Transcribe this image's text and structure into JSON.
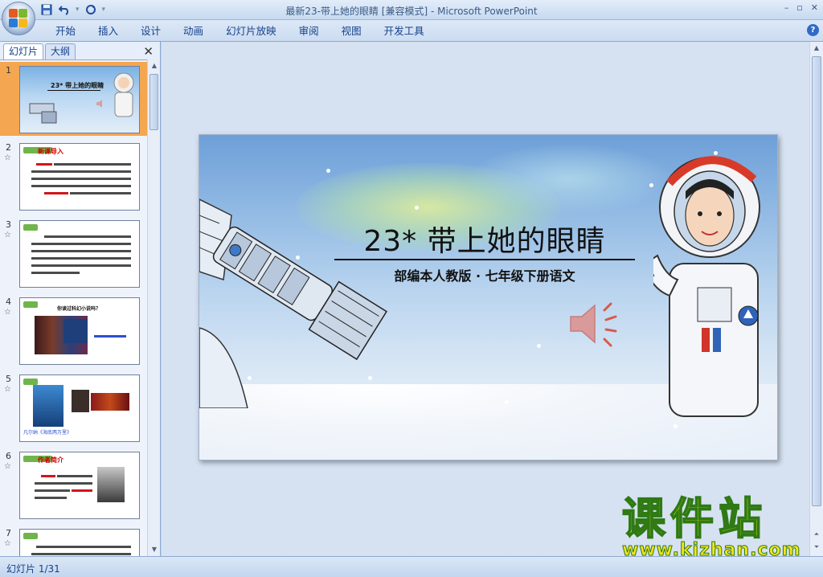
{
  "window": {
    "title": "最新23-带上她的眼睛 [兼容模式] - Microsoft PowerPoint",
    "controls": [
      "–",
      "▫",
      "✕"
    ]
  },
  "quick_access": {
    "icons": [
      "save-icon",
      "undo-icon",
      "redo-icon",
      "customize-icon"
    ]
  },
  "ribbon": {
    "tabs": [
      "开始",
      "插入",
      "设计",
      "动画",
      "幻灯片放映",
      "审阅",
      "视图",
      "开发工具"
    ],
    "help_label": "?"
  },
  "left_panel": {
    "tabs": [
      "幻灯片",
      "大纲"
    ],
    "active_tab": "幻灯片",
    "close_label": "✕",
    "thumbnails": [
      {
        "num": "1",
        "selected": true,
        "title": "23*  带上她的眼睛"
      },
      {
        "num": "2",
        "star": "☆",
        "tag": "新课导入"
      },
      {
        "num": "3",
        "star": "☆"
      },
      {
        "num": "4",
        "star": "☆",
        "caption": "你读过科幻小说吗？"
      },
      {
        "num": "5",
        "star": "☆",
        "caption": "凡尔纳《海底两万里》"
      },
      {
        "num": "6",
        "star": "☆",
        "tag": "作者简介"
      },
      {
        "num": "7",
        "star": "☆"
      }
    ]
  },
  "slide": {
    "title": "23*    带上她的眼睛",
    "subtitle": "部编本人教版 · 七年级下册语文"
  },
  "watermark": {
    "big": "课件站",
    "url": "www.kjzhan.com"
  },
  "status": {
    "slide_counter": "幻灯片 1/31"
  }
}
